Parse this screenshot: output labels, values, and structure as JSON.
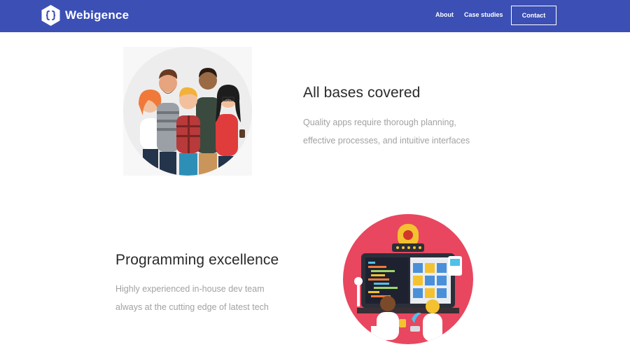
{
  "navbar": {
    "brand_name": "Webigence",
    "logo_icon": "hexagon-braces-icon",
    "links": {
      "about": "About",
      "case_studies": "Case studies",
      "contact": "Contact"
    },
    "background_color": "#3b4fb4"
  },
  "features": [
    {
      "title": "All bases covered",
      "description_lines": [
        "Quality apps require thorough planning,",
        "effective processes, and intuitive interfaces"
      ],
      "illustration": "team-people-illustration"
    },
    {
      "title": "Programming excellence",
      "description_lines": [
        "Highly experienced in-house dev team",
        "always at the cutting edge of latest tech"
      ],
      "illustration": "developers-at-monitor-illustration"
    }
  ],
  "colors": {
    "accent": "#3b4fb4",
    "illustration_pink": "#e8475f",
    "title_text": "#2a2a2a",
    "body_text": "#a2a2a2"
  }
}
